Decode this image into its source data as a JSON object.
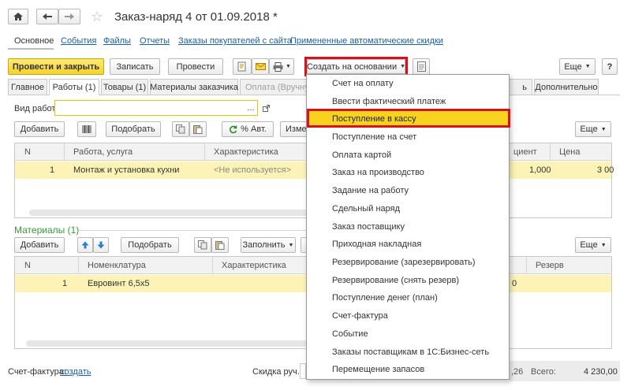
{
  "window": {
    "title": "Заказ-наряд 4 от 01.09.2018 *"
  },
  "nav": [
    "Основное",
    "События",
    "Файлы",
    "Отчеты",
    "Заказы покупателей с сайта",
    "Примененные автоматические скидки"
  ],
  "toolbar": {
    "post_close": "Провести и закрыть",
    "save": "Записать",
    "post": "Провести",
    "create_based": "Создать на основании",
    "more": "Еще",
    "help": "?"
  },
  "tabs": [
    "Главное",
    "Работы (1)",
    "Товары (1)",
    "Материалы заказчика",
    "Оплата (Вручную)",
    "ь",
    "Дополнительно"
  ],
  "works": {
    "kind_label": "Вид работ:",
    "kind_value": "",
    "add": "Добавить",
    "pick": "Подобрать",
    "pct_auto": "% Авт.",
    "change": "Изме",
    "more": "Еще",
    "columns": [
      "N",
      "Работа, услуга",
      "Характеристика",
      "циент",
      "Цена"
    ],
    "row": {
      "n": "1",
      "work": "Монтаж и установка кухни",
      "characteristic": "<Не используется>",
      "coef": "1,000",
      "price": "3 00"
    }
  },
  "materials": {
    "title": "Материалы (1)",
    "add": "Добавить",
    "pick": "Подобрать",
    "fill": "Заполнить",
    "more": "Еще",
    "columns": [
      "N",
      "Номенклатура",
      "Характеристика",
      "Резерв"
    ],
    "row": {
      "n": "1",
      "item": "Евровинт 6,5х5",
      "characteristic": "",
      "qty_tail": "0"
    }
  },
  "footer": {
    "invoice_label": "Счет-фактура:",
    "invoice_link": "создать",
    "discount_label": "Скидка руч.:",
    "discount_tail": ",26",
    "total_label": "Всего:",
    "total_value": "4 230,00"
  },
  "menu": {
    "items": [
      "Счет на оплату",
      "Ввести фактический платеж",
      "Поступление в кассу",
      "Поступление на счет",
      "Оплата картой",
      "Заказ на производство",
      "Задание на работу",
      "Сдельный наряд",
      "Заказ поставщику",
      "Приходная накладная",
      "Резервирование (зарезервировать)",
      "Резервирование (снять резерв)",
      "Поступление денег (план)",
      "Счет-фактура",
      "Событие",
      "Заказы поставщикам в 1С:Бизнес-сеть",
      "Перемещение запасов"
    ],
    "highlighted_index": 2
  },
  "colors": {
    "accent_yellow": "#f5d22a",
    "highlight_red": "#d4131b",
    "link_blue": "#1a5fa8",
    "selected_row": "#fdf3b6",
    "materials_green": "#3a9a3a"
  }
}
